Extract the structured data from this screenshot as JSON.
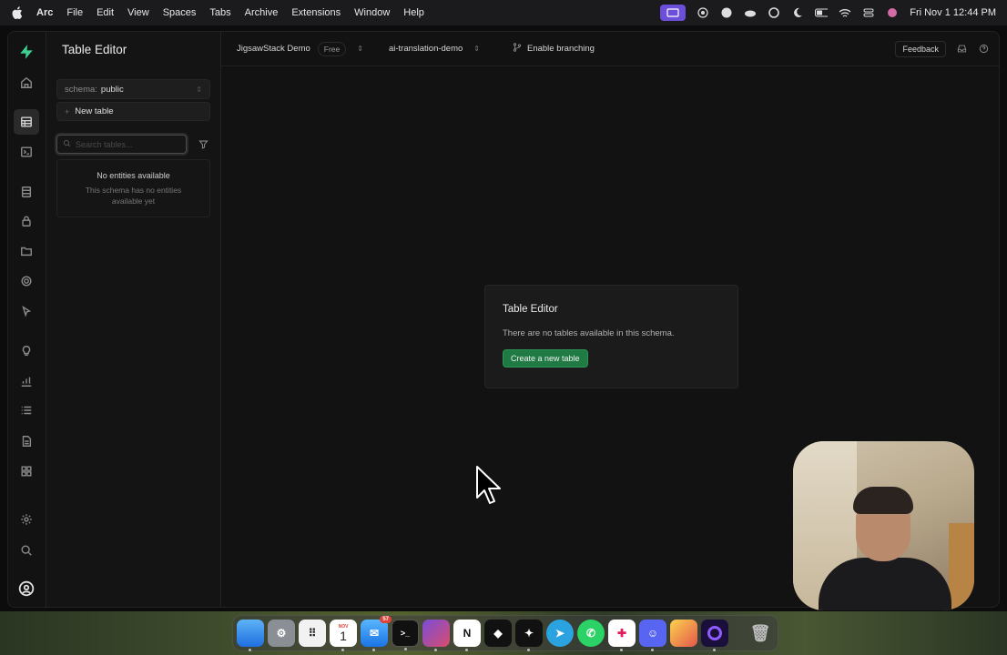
{
  "menubar": {
    "app_name": "Arc",
    "menus": [
      "File",
      "Edit",
      "View",
      "Spaces",
      "Tabs",
      "Archive",
      "Extensions",
      "Window",
      "Help"
    ],
    "clock": "Fri Nov 1  12:44 PM",
    "status_icons": [
      "screen-record-icon",
      "record-icon",
      "arc-icon",
      "cloud-icon",
      "grammarly-icon",
      "moon-icon",
      "battery-icon",
      "wifi-icon",
      "control-center-icon",
      "siri-icon"
    ]
  },
  "sidebar_rail": {
    "icons": [
      "home-icon",
      "table-icon",
      "terminal-icon",
      "database-icon",
      "auth-lock-icon",
      "storage-folder-icon",
      "realtime-icon",
      "cursor-icon",
      "lightbulb-icon",
      "chart-icon",
      "list-icon",
      "document-icon",
      "extensions-icon",
      "settings-icon",
      "search-icon",
      "profile-icon"
    ],
    "selected": "table-icon"
  },
  "side_panel": {
    "title": "Table Editor",
    "schema_label": "schema:",
    "schema_value": "public",
    "new_table_label": "New table",
    "search_placeholder": "Search tables...",
    "empty_title": "No entities available",
    "empty_desc": "This schema has no entities available yet"
  },
  "topbar": {
    "org": "JigsawStack Demo",
    "plan_badge": "Free",
    "project": "ai-translation-demo",
    "branching": "Enable branching",
    "feedback": "Feedback"
  },
  "main": {
    "card_title": "Table Editor",
    "card_desc": "There are no tables available in this schema.",
    "create_button": "Create a new table"
  },
  "dock": {
    "apps": [
      "finder",
      "system-settings",
      "launchpad",
      "calendar",
      "mail",
      "terminal",
      "affinity",
      "notion",
      "blocks",
      "figma",
      "telegram",
      "whatsapp",
      "slack",
      "discord",
      "notes",
      "arc",
      "trash"
    ],
    "calendar_month": "NOV",
    "calendar_day": "1",
    "mail_badge": "57"
  }
}
